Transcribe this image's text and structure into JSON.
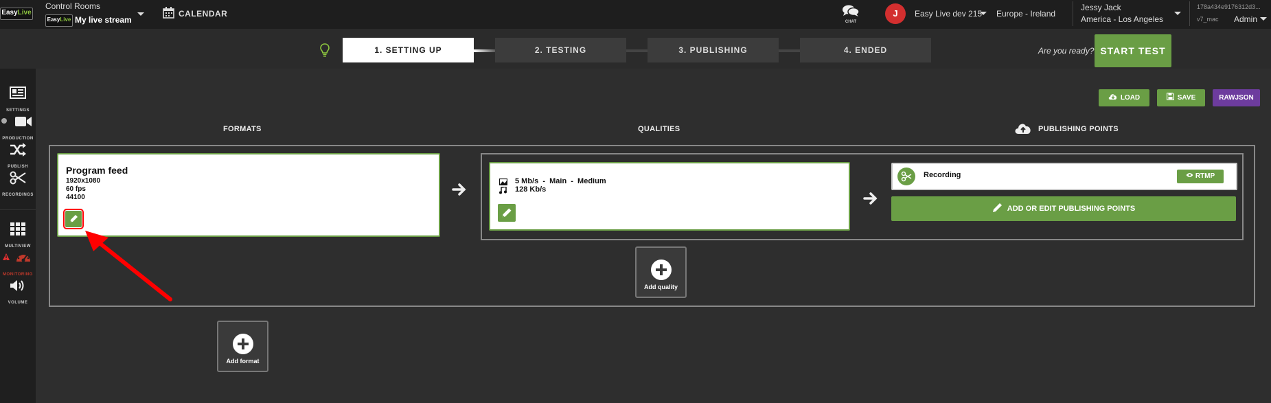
{
  "topbar": {
    "logo_easy": "Easy",
    "logo_live": "Live",
    "control_rooms": "Control Rooms",
    "stream_name": "My live stream",
    "calendar": "CALENDAR",
    "chat": "CHAT",
    "account_initial": "J",
    "account_name": "Easy Live dev 215",
    "region": "Europe - Ireland",
    "user_name": "Jessy Jack",
    "timezone": "America - Los Angeles",
    "session_id": "178a434e9176312d3...",
    "client": "v7_mac",
    "role": "Admin"
  },
  "steps": [
    {
      "label": "1.  SETTING UP",
      "active": true
    },
    {
      "label": "2. TESTING",
      "active": false
    },
    {
      "label": "3. PUBLISHING",
      "active": false
    },
    {
      "label": "4.  ENDED",
      "active": false
    }
  ],
  "ready_text": "Are you ready?",
  "start_test": "START TEST",
  "sidebar": {
    "items": [
      {
        "label": "SETTINGS",
        "icon": "settings-icon"
      },
      {
        "label": "PRODUCTION",
        "icon": "video-camera-icon"
      },
      {
        "label": "PUBLISH",
        "icon": "shuffle-icon"
      },
      {
        "label": "RECORDINGS",
        "icon": "scissors-icon"
      },
      {
        "label": "MULTIVIEW",
        "icon": "grid-icon"
      },
      {
        "label": "MONITORING",
        "icon": "dashboard-icon"
      },
      {
        "label": "VOLUME",
        "icon": "volume-icon"
      }
    ]
  },
  "toolbar": {
    "load": "LOAD",
    "save": "SAVE",
    "rawjson": "RAWJSON"
  },
  "columns": {
    "formats": "FORMATS",
    "qualities": "QUALITIES",
    "publishing_points": "PUBLISHING POINTS"
  },
  "format": {
    "title": "Program feed",
    "resolution": "1920x1080",
    "fps": "60 fps",
    "audio_rate": "44100"
  },
  "quality": {
    "video": "5 Mb/s  -  Main  -  Medium",
    "audio": "128 Kb/s"
  },
  "publishing": {
    "name": "Recording",
    "protocol": "RTMP",
    "add_edit": "ADD OR EDIT PUBLISHING POINTS"
  },
  "add_quality": "Add quality",
  "add_format": "Add format",
  "colors": {
    "accent_green": "#6a9e45",
    "rawjson_purple": "#6d3c9e",
    "annotation_red": "#ff0000",
    "avatar_red": "#d32f2f"
  }
}
